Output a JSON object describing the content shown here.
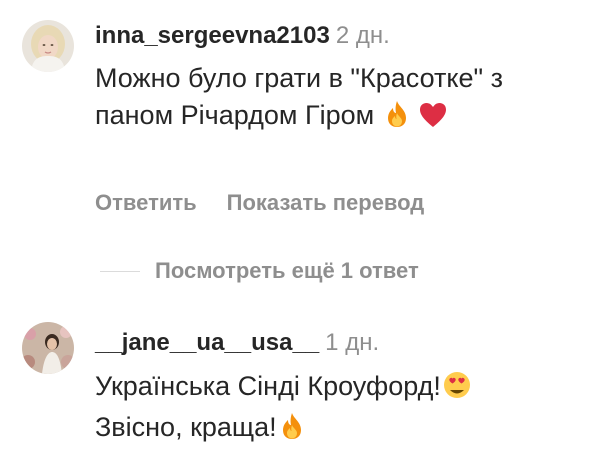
{
  "comments": [
    {
      "username": "inna_sergeevna2103",
      "time": "2 дн.",
      "text": "Можно  було грати в \"Красотке\"  з паном Річардом Гіром",
      "emojis": [
        "fire-emoji",
        "heart-emoji"
      ],
      "actions": {
        "reply": "Ответить",
        "translate": "Показать перевод"
      },
      "more_replies": "Посмотреть ещё 1 ответ"
    },
    {
      "username": "__jane__ua__usa__",
      "time": "1 дн.",
      "text_line1": "Українська Сінді Кроуфорд!",
      "text_line2": "Звісно, краща!",
      "emojis": [
        "heart-eyes-emoji",
        "fire-emoji"
      ]
    }
  ],
  "colors": {
    "text": "#262626",
    "muted": "#8e8e8e",
    "divider": "#dbdbdb"
  }
}
